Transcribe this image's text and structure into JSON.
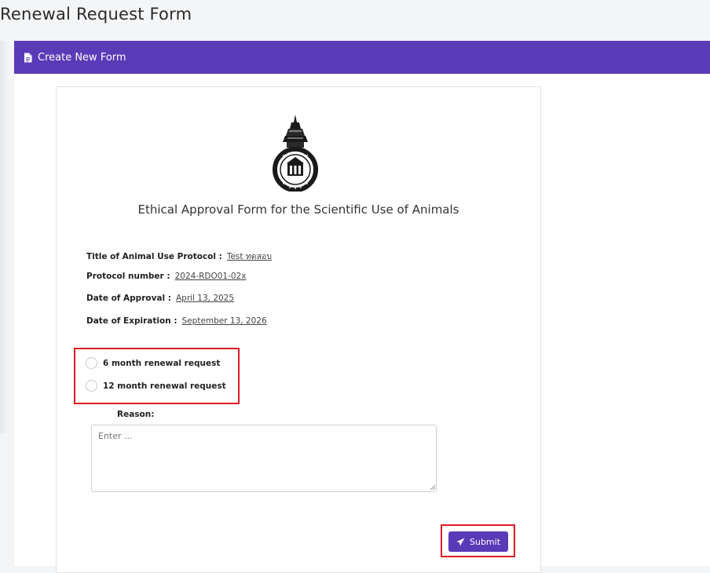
{
  "page": {
    "title": "Renewal Request Form"
  },
  "header": {
    "label": "Create New Form",
    "icon": "document-icon",
    "color": "#5b3ab8"
  },
  "form": {
    "heading": "Ethical Approval Form for the Scientific Use of Animals",
    "fields": [
      {
        "label": "Title of Animal Use Protocol :",
        "value": "Test ทดสอบ"
      },
      {
        "label": "Protocol number :",
        "value": "2024-RDO01-02x"
      },
      {
        "label": "Date of Approval :",
        "value": "April 13, 2025"
      },
      {
        "label": "Date of Expiration :",
        "value": "September 13, 2026"
      }
    ],
    "renewal_options": [
      {
        "label": "6 month renewal request",
        "selected": false
      },
      {
        "label": "12 month renewal request",
        "selected": false
      }
    ],
    "reason": {
      "label": "Reason:",
      "placeholder": "Enter ...",
      "value": ""
    },
    "submit": {
      "label": "Submit",
      "icon": "paper-plane-icon"
    }
  },
  "colors": {
    "accent": "#5b3ab8",
    "highlight": "#e01b24"
  }
}
